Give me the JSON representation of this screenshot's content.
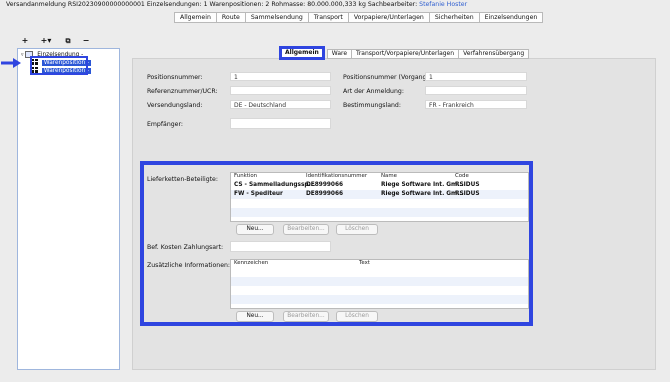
{
  "header": {
    "prefix": "Versandanmeldung RSI20230900000000001  Einzelsendungen: 1  Warenpositionen: 2  Rohmasse: 80.000.000,333 kg  Sachbearbeiter:",
    "user": "Stefanie Hoster"
  },
  "top_tabs": [
    "Allgemein",
    "Route",
    "Sammelsendung",
    "Transport",
    "Vorpapiere/Unterlagen",
    "Sicherheiten",
    "Einzelsendungen"
  ],
  "toolbar": {
    "add": "+",
    "add_menu": "+▾",
    "copy": "⧉",
    "remove": "−"
  },
  "tree": {
    "root": "Einzelsendung -",
    "items": [
      "Warenposition -",
      "Warenposition -"
    ]
  },
  "sub_tabs": [
    "Allgemein",
    "Ware",
    "Transport/Vorpapiere/Unterlagen",
    "Verfahrensübergang"
  ],
  "form": {
    "positionsnummer_label": "Positionsnummer:",
    "positionsnummer_value": "1",
    "positionsnummer_vorgang_label": "Positionsnummer (Vorgang):",
    "positionsnummer_vorgang_value": "1",
    "referenz_label": "Referenznummer/UCR:",
    "referenz_value": "",
    "art_label": "Art der Anmeldung:",
    "art_value": "",
    "versendungsland_label": "Versendungsland:",
    "versendungsland_value": "DE - Deutschland",
    "bestimmungsland_label": "Bestimmungsland:",
    "bestimmungsland_value": "FR - Frankreich",
    "empfaenger_label": "Empfänger:",
    "empfaenger_value": ""
  },
  "lieferketten": {
    "label": "Lieferketten-Beteiligte:",
    "columns": [
      "Funktion",
      "Identifikationsnummer",
      "Name",
      "Code"
    ],
    "rows": [
      [
        "CS - Sammelladungssp...",
        "DE8999066",
        "Riege Software Int. Gm...",
        "RSIDUS"
      ],
      [
        "FW - Spediteur",
        "DE8999066",
        "Riege Software Int. Gm...",
        "RSIDUS"
      ]
    ],
    "buttons": {
      "neu": "Neu...",
      "bearbeiten": "Bearbeiten...",
      "loeschen": "Löschen"
    }
  },
  "kosten": {
    "label": "Bef. Kosten Zahlungsart:",
    "value": ""
  },
  "zusatz": {
    "label": "Zusätzliche Informationen:",
    "columns": [
      "Kennzeichen",
      "Text"
    ],
    "buttons": {
      "neu": "Neu...",
      "bearbeiten": "Bearbeiten...",
      "loeschen": "Löschen"
    }
  },
  "colors": {
    "highlight": "#2f45e0",
    "selection": "#2b56d6"
  }
}
